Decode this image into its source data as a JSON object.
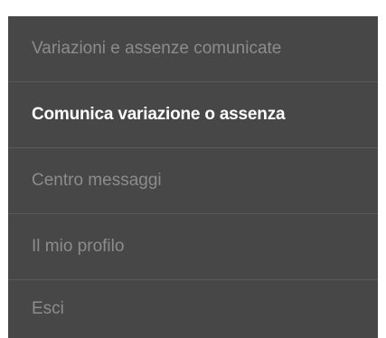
{
  "menu": {
    "items": [
      {
        "label": "Variazioni e assenze comunicate",
        "active": false
      },
      {
        "label": "Comunica variazione o assenza",
        "active": true
      },
      {
        "label": "Centro messaggi",
        "active": false
      },
      {
        "label": "Il mio profilo",
        "active": false
      },
      {
        "label": "Esci",
        "active": false
      }
    ],
    "colors": {
      "background": "#474747",
      "divider": "#595959",
      "text_inactive": "#8c8c8c",
      "text_active": "#ffffff"
    }
  }
}
